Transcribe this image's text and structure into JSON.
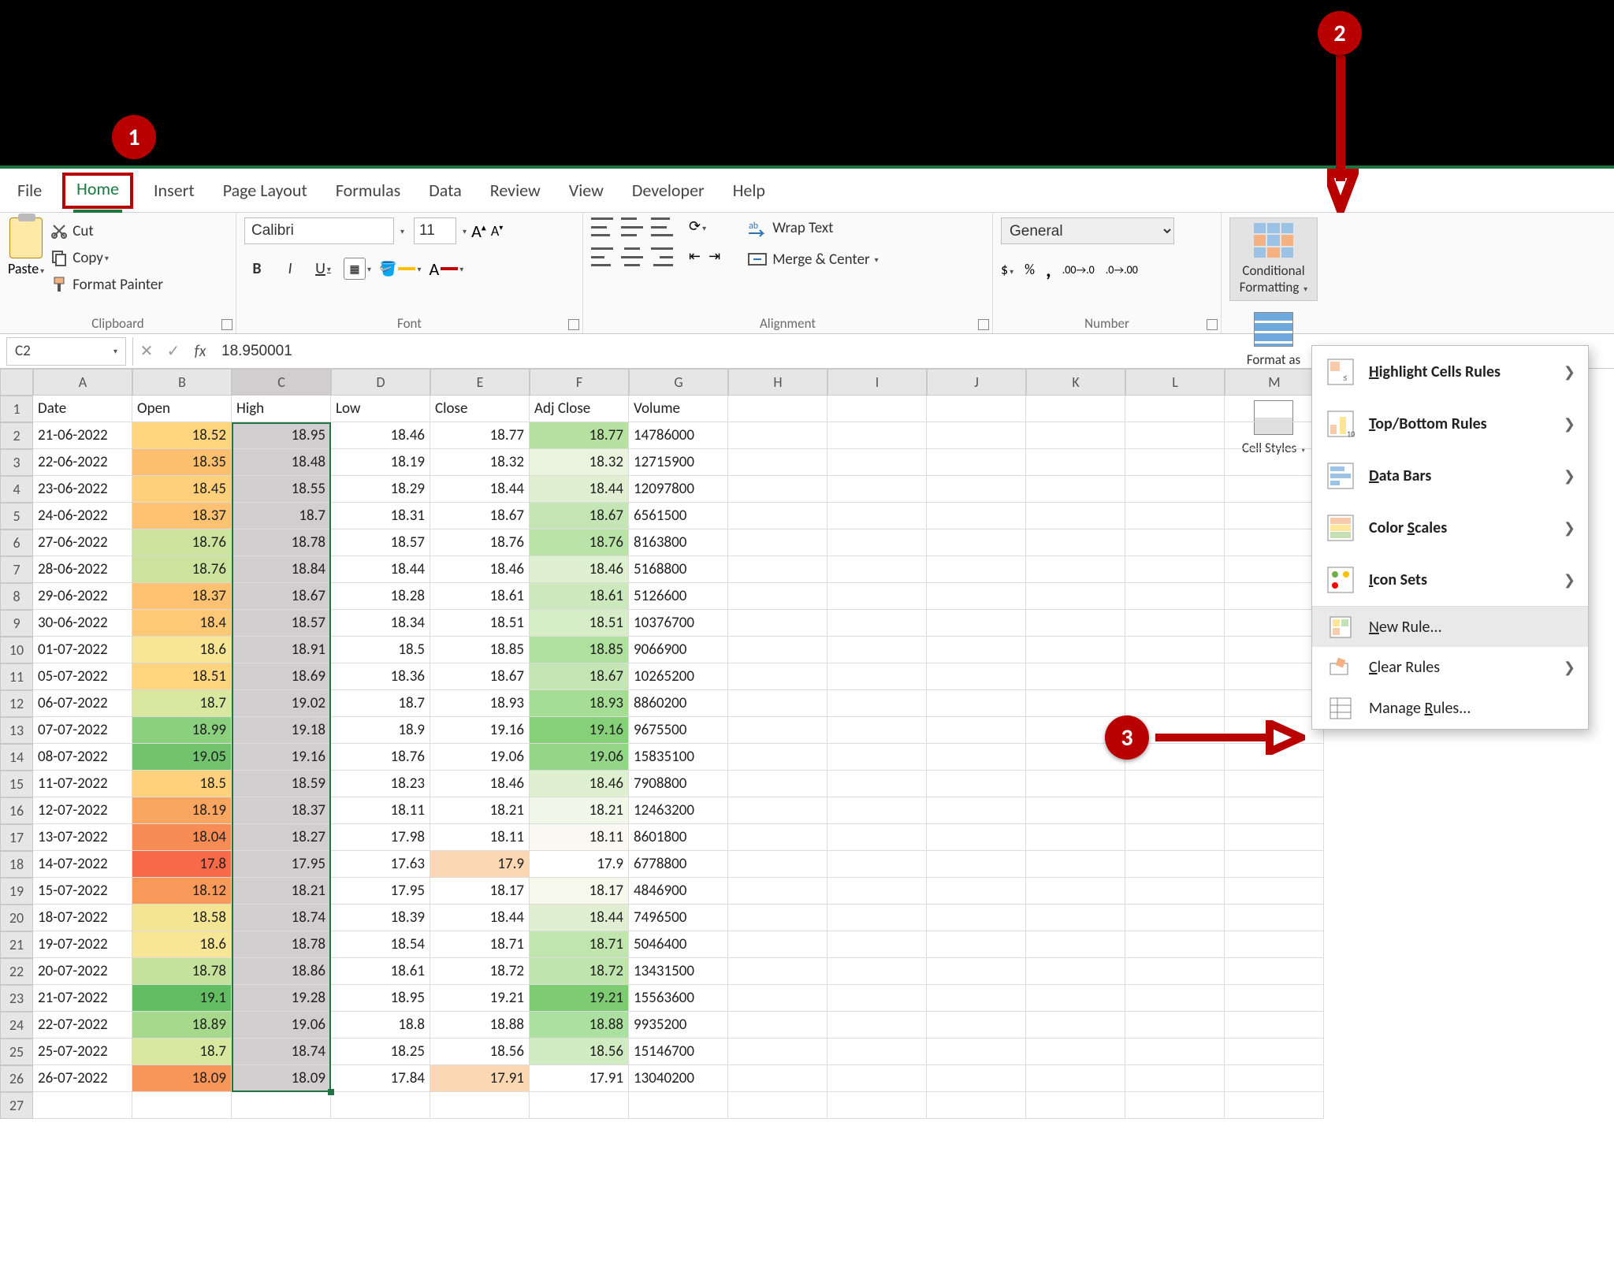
{
  "annotations": {
    "badge1": "1",
    "badge2": "2",
    "badge3": "3"
  },
  "tabs": {
    "file": "File",
    "home": "Home",
    "insert": "Insert",
    "pageLayout": "Page Layout",
    "formulas": "Formulas",
    "data": "Data",
    "review": "Review",
    "view": "View",
    "developer": "Developer",
    "help": "Help"
  },
  "ribbon": {
    "clipboard": {
      "label": "Clipboard",
      "paste": "Paste",
      "cut": "Cut",
      "copy": "Copy",
      "formatPainter": "Format Painter"
    },
    "font": {
      "label": "Font",
      "name": "Calibri",
      "size": "11"
    },
    "alignment": {
      "label": "Alignment",
      "wrap": "Wrap Text",
      "merge": "Merge & Center"
    },
    "number": {
      "label": "Number",
      "format": "General"
    },
    "styles": {
      "cf": "Conditional Formatting",
      "fat": "Format as Table",
      "cs": "Cell Styles"
    }
  },
  "cfMenu": {
    "highlight": "Highlight Cells Rules",
    "topBottom": "Top/Bottom Rules",
    "dataBars": "Data Bars",
    "colorScales": "Color Scales",
    "iconSets": "Icon Sets",
    "newRule": "New Rule...",
    "clearRules": "Clear Rules",
    "manageRules": "Manage Rules..."
  },
  "formulaBar": {
    "nameBox": "C2",
    "formula": "18.950001"
  },
  "columns": [
    "A",
    "B",
    "C",
    "D",
    "E",
    "F",
    "G",
    "H",
    "I",
    "J",
    "K",
    "L",
    "M"
  ],
  "headers": {
    "A": "Date",
    "B": "Open",
    "C": "High",
    "D": "Low",
    "E": "Close",
    "F": "Adj Close",
    "G": "Volume"
  },
  "rows": [
    {
      "n": 1
    },
    {
      "n": 2,
      "A": "21-06-2022",
      "B": 18.52,
      "C": 18.95,
      "D": 18.46,
      "E": 18.77,
      "F": 18.77,
      "G": 14786000,
      "Bc": "#ffd47f",
      "Fc": "#b7e1a1"
    },
    {
      "n": 3,
      "A": "22-06-2022",
      "B": 18.35,
      "C": 18.48,
      "D": 18.19,
      "E": 18.32,
      "F": 18.32,
      "G": 12715900,
      "Bc": "#fcbf6f",
      "Fc": "#e9f3dd"
    },
    {
      "n": 4,
      "A": "23-06-2022",
      "B": 18.45,
      "C": 18.55,
      "D": 18.29,
      "E": 18.44,
      "F": 18.44,
      "G": 12097800,
      "Bc": "#ffcf7b",
      "Fc": "#e0efd2"
    },
    {
      "n": 5,
      "A": "24-06-2022",
      "B": 18.37,
      "C": 18.7,
      "D": 18.31,
      "E": 18.67,
      "F": 18.67,
      "G": 6561500,
      "Bc": "#fdc271",
      "Fc": "#c4e6b4"
    },
    {
      "n": 6,
      "A": "27-06-2022",
      "B": 18.76,
      "C": 18.78,
      "D": 18.57,
      "E": 18.76,
      "F": 18.76,
      "G": 8163800,
      "Bc": "#cbe39c",
      "Fc": "#bae3aa"
    },
    {
      "n": 7,
      "A": "28-06-2022",
      "B": 18.76,
      "C": 18.84,
      "D": 18.44,
      "E": 18.46,
      "F": 18.46,
      "G": 5168800,
      "Bc": "#cbe39c",
      "Fc": "#def0d0"
    },
    {
      "n": 8,
      "A": "29-06-2022",
      "B": 18.37,
      "C": 18.67,
      "D": 18.28,
      "E": 18.61,
      "F": 18.61,
      "G": 5126600,
      "Bc": "#fdc271",
      "Fc": "#cbe9bc"
    },
    {
      "n": 9,
      "A": "30-06-2022",
      "B": 18.4,
      "C": 18.57,
      "D": 18.34,
      "E": 18.51,
      "F": 18.51,
      "G": 10376700,
      "Bc": "#fec976",
      "Fc": "#d6edc8"
    },
    {
      "n": 10,
      "A": "01-07-2022",
      "B": 18.6,
      "C": 18.91,
      "D": 18.5,
      "E": 18.85,
      "F": 18.85,
      "G": 9066900,
      "Bc": "#f6e696",
      "Fc": "#afe09e"
    },
    {
      "n": 11,
      "A": "05-07-2022",
      "B": 18.51,
      "C": 18.69,
      "D": 18.36,
      "E": 18.67,
      "F": 18.67,
      "G": 10265200,
      "Bc": "#ffd47f",
      "Fc": "#c4e6b4"
    },
    {
      "n": 12,
      "A": "06-07-2022",
      "B": 18.7,
      "C": 19.02,
      "D": 18.7,
      "E": 18.93,
      "F": 18.93,
      "G": 8860200,
      "Bc": "#d9e79f",
      "Fc": "#a6dd94"
    },
    {
      "n": 13,
      "A": "07-07-2022",
      "B": 18.99,
      "C": 19.18,
      "D": 18.9,
      "E": 19.16,
      "F": 19.16,
      "G": 9675500,
      "Bc": "#8ad07e",
      "Fc": "#86d07a"
    },
    {
      "n": 14,
      "A": "08-07-2022",
      "B": 19.05,
      "C": 19.16,
      "D": 18.76,
      "E": 19.06,
      "F": 19.06,
      "G": 15835100,
      "Bc": "#72c36e",
      "Fc": "#94d688"
    },
    {
      "n": 15,
      "A": "11-07-2022",
      "B": 18.5,
      "C": 18.59,
      "D": 18.23,
      "E": 18.46,
      "F": 18.46,
      "G": 7908800,
      "Bc": "#ffd17d",
      "Fc": "#def0d0"
    },
    {
      "n": 16,
      "A": "12-07-2022",
      "B": 18.19,
      "C": 18.37,
      "D": 18.11,
      "E": 18.21,
      "F": 18.21,
      "G": 12463200,
      "Bc": "#faa560",
      "Fc": "#f3f7e9"
    },
    {
      "n": 17,
      "A": "13-07-2022",
      "B": 18.04,
      "C": 18.27,
      "D": 17.98,
      "E": 18.11,
      "F": 18.11,
      "G": 8601800,
      "Bc": "#f78d54",
      "Fc": "#faf9f1"
    },
    {
      "n": 18,
      "A": "14-07-2022",
      "B": 17.8,
      "C": 17.95,
      "D": 17.63,
      "E": 17.9,
      "F": 17.9,
      "G": 6778800,
      "Bc": "#f76b48",
      "Ec": "#fcd7b3",
      "Fc": "#ffffff"
    },
    {
      "n": 19,
      "A": "15-07-2022",
      "B": 18.12,
      "C": 18.21,
      "D": 17.95,
      "E": 18.17,
      "F": 18.17,
      "G": 4846900,
      "Bc": "#f99a5a",
      "Fc": "#f6f8ec"
    },
    {
      "n": 20,
      "A": "18-07-2022",
      "B": 18.58,
      "C": 18.74,
      "D": 18.39,
      "E": 18.44,
      "F": 18.44,
      "G": 7496500,
      "Bc": "#f3e594",
      "Fc": "#e0efd2"
    },
    {
      "n": 21,
      "A": "19-07-2022",
      "B": 18.6,
      "C": 18.78,
      "D": 18.54,
      "E": 18.71,
      "F": 18.71,
      "G": 5046400,
      "Bc": "#f6e696",
      "Fc": "#c0e5af"
    },
    {
      "n": 22,
      "A": "20-07-2022",
      "B": 18.78,
      "C": 18.86,
      "D": 18.61,
      "E": 18.72,
      "F": 18.72,
      "G": 13431500,
      "Bc": "#c6e19b",
      "Fc": "#bfe4ae"
    },
    {
      "n": 23,
      "A": "21-07-2022",
      "B": 19.1,
      "C": 19.28,
      "D": 18.95,
      "E": 19.21,
      "F": 19.21,
      "G": 15563600,
      "Bc": "#63be63",
      "Fc": "#7ecc72"
    },
    {
      "n": 24,
      "A": "22-07-2022",
      "B": 18.89,
      "C": 19.06,
      "D": 18.8,
      "E": 18.88,
      "F": 18.88,
      "G": 9935200,
      "Bc": "#a7d98c",
      "Fc": "#ace0a0"
    },
    {
      "n": 25,
      "A": "25-07-2022",
      "B": 18.7,
      "C": 18.74,
      "D": 18.25,
      "E": 18.56,
      "F": 18.56,
      "G": 15146700,
      "Bc": "#d9e79f",
      "Fc": "#d1ebc2"
    },
    {
      "n": 26,
      "A": "26-07-2022",
      "B": 18.09,
      "C": 18.09,
      "D": 17.84,
      "E": 17.91,
      "F": 17.91,
      "G": 13040200,
      "Bc": "#f89558",
      "Ec": "#fcd7b3",
      "Fc": "#ffffff"
    },
    {
      "n": 27
    }
  ]
}
